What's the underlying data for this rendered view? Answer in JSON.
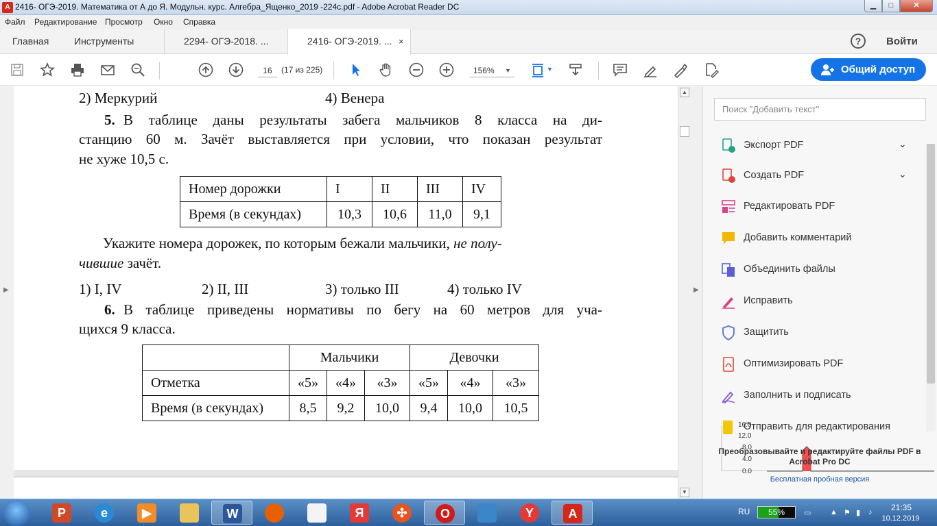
{
  "window": {
    "title": "2416- ОГЭ-2019. Математика от А до Я. Модульн. курс. Алгебра_Ященко_2019 -224c.pdf - Adobe Acrobat Reader DC",
    "minimize": "▁",
    "maximize": "□",
    "close": "✕"
  },
  "menu": [
    "Файл",
    "Редактирование",
    "Просмотр",
    "Окно",
    "Справка"
  ],
  "tabs": {
    "home": "Главная",
    "tools": "Инструменты",
    "doc1": "2294- ОГЭ-2018. ...",
    "doc2": "2416- ОГЭ-2019. ...",
    "close_glyph": "×"
  },
  "header_right": {
    "help": "?",
    "login": "Войти"
  },
  "toolbar": {
    "page_current": "16",
    "page_count": "(17 из 225)",
    "zoom": "156%",
    "share_label": "Общий доступ"
  },
  "document": {
    "line_a_left": "2) Меркурий",
    "line_a_right": "4) Венера",
    "q5_num": "5.",
    "q5_l1": "В таблице даны результаты забега мальчиков 8 класса на ди-",
    "q5_l2": "станцию 60 м. Зачёт выставляется при условии, что показан результат",
    "q5_l3": "не хуже 10,5 с.",
    "t1": {
      "row1": [
        "Номер дорожки",
        "I",
        "II",
        "III",
        "IV"
      ],
      "row2": [
        "Время (в секундах)",
        "10,3",
        "10,6",
        "11,0",
        "9,1"
      ]
    },
    "q5_ask_l1a": "Укажите номера дорожек, по которым бежали мальчики,",
    "q5_ask_l1b": "не полу-",
    "q5_ask_l2a": "чившие",
    "q5_ask_l2b": "зачёт.",
    "answers": [
      "1) I, IV",
      "2) II, III",
      "3) только III",
      "4) только IV"
    ],
    "q6_num": "6.",
    "q6_l1": "В таблице приведены нормативы по бегу на 60 метров для уча-",
    "q6_l2": "щихся 9 класса.",
    "t2": {
      "boys": "Мальчики",
      "girls": "Девочки",
      "grade_label": "Отметка",
      "grades": [
        "«5»",
        "«4»",
        "«3»",
        "«5»",
        "«4»",
        "«3»"
      ],
      "time_label": "Время (в секундах)",
      "times": [
        "8,5",
        "9,2",
        "10,0",
        "9,4",
        "10,0",
        "10,5"
      ]
    }
  },
  "right_pane": {
    "search_placeholder": "Поиск \"Добавить текст\"",
    "items": [
      {
        "label": "Экспорт PDF",
        "icon": "export-pdf-icon",
        "color": "#26a18a"
      },
      {
        "label": "Создать PDF",
        "icon": "create-pdf-icon",
        "color": "#e0443a"
      },
      {
        "label": "Редактировать PDF",
        "icon": "edit-pdf-icon",
        "color": "#d9428a"
      },
      {
        "label": "Добавить комментарий",
        "icon": "comment-icon",
        "color": "#f2b705"
      },
      {
        "label": "Объединить файлы",
        "icon": "combine-files-icon",
        "color": "#5b5fd6"
      },
      {
        "label": "Исправить",
        "icon": "fix-icon",
        "color": "#d9428a"
      },
      {
        "label": "Защитить",
        "icon": "protect-icon",
        "color": "#5b6fd6"
      },
      {
        "label": "Оптимизировать PDF",
        "icon": "optimize-pdf-icon",
        "color": "#e0443a"
      },
      {
        "label": "Заполнить и подписать",
        "icon": "fill-sign-icon",
        "color": "#8a5bd6"
      },
      {
        "label": "Отправить для редактирования",
        "icon": "send-for-review-icon",
        "color": "#f2c705"
      }
    ],
    "promo": "Преобразовывайте и редактируйте файлы PDF в Acrobat Pro DC",
    "promo_link": "Бесплатная пробная версия",
    "graph_labels": [
      "16.0",
      "12.0",
      "8.0",
      "4.0",
      "0.0"
    ]
  },
  "taskbar": {
    "lang": "RU",
    "battery": "55%",
    "battery_level": 0.55,
    "time": "21:35",
    "date": "10.12.2019"
  }
}
